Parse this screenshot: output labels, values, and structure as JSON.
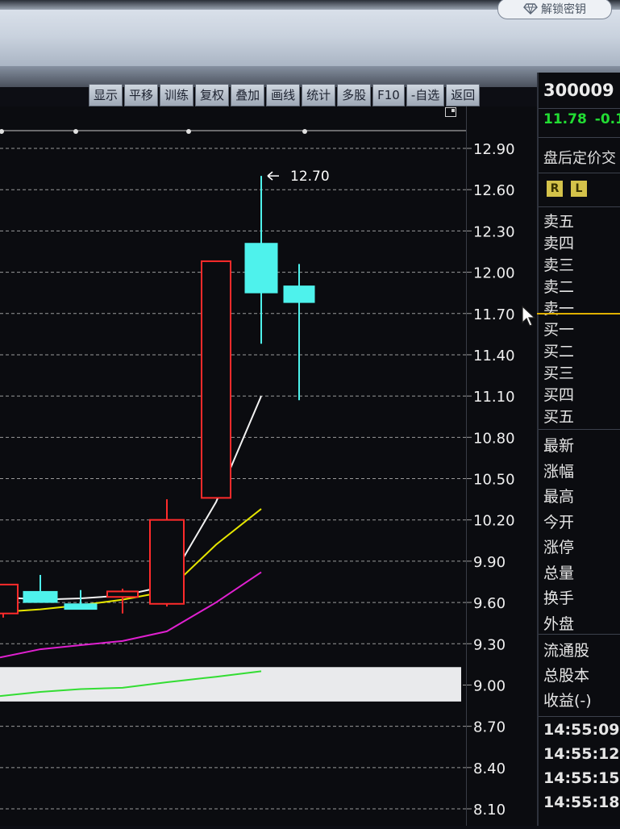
{
  "header": {
    "unlock_label": "解锁密钥"
  },
  "toolbar": {
    "buttons": [
      "显示",
      "平移",
      "训练",
      "复权",
      "叠加",
      "画线",
      "统计",
      "多股",
      "F10",
      "-自选",
      "返回"
    ]
  },
  "quote": {
    "code": "300009",
    "price": "11.78",
    "change": "-0.1",
    "after_hours_label": "盘后定价交",
    "r_label": "R",
    "l_label": "L",
    "asks": [
      "卖五",
      "卖四",
      "卖三",
      "卖二",
      "卖一"
    ],
    "bids": [
      "买一",
      "买二",
      "买三",
      "买四",
      "买五"
    ],
    "stats": [
      "最新",
      "涨幅",
      "最高",
      "今开",
      "涨停",
      "总量",
      "换手",
      "外盘"
    ],
    "shares": [
      "流通股",
      "总股本",
      "收益(-)"
    ],
    "ticks": [
      "14:55:09",
      "14:55:12",
      "14:55:15",
      "14:55:18"
    ]
  },
  "chart_data": {
    "type": "candlestick",
    "y_ticks": [
      "12.90",
      "12.60",
      "12.30",
      "12.00",
      "11.70",
      "11.40",
      "11.10",
      "10.80",
      "10.50",
      "10.20",
      "9.90",
      "9.60",
      "9.30",
      "9.00",
      "8.70",
      "8.40",
      "8.10"
    ],
    "ylim": [
      8.1,
      12.9
    ],
    "high_annotation": "12.70",
    "candles": [
      {
        "open": 9.52,
        "close": 9.73,
        "high": 9.73,
        "low": 9.49,
        "color": "red"
      },
      {
        "open": 9.6,
        "close": 9.68,
        "high": 9.8,
        "low": 9.6,
        "color": "cyan"
      },
      {
        "open": 9.55,
        "close": 9.59,
        "high": 9.69,
        "low": 9.55,
        "color": "cyan"
      },
      {
        "open": 9.68,
        "close": 9.64,
        "high": 9.7,
        "low": 9.52,
        "color": "red"
      },
      {
        "open": 9.59,
        "close": 10.2,
        "high": 10.35,
        "low": 9.57,
        "color": "red"
      },
      {
        "open": 10.36,
        "close": 12.08,
        "high": 12.08,
        "low": 10.36,
        "color": "red"
      },
      {
        "open": 12.21,
        "close": 11.85,
        "high": 12.7,
        "low": 11.48,
        "color": "cyan"
      },
      {
        "open": 11.9,
        "close": 11.78,
        "high": 12.06,
        "low": 11.07,
        "color": "cyan"
      }
    ],
    "series": [
      {
        "values": [
          9.64,
          9.62,
          9.63,
          9.65,
          9.72,
          10.33,
          11.1
        ],
        "color": "#f2f2f2"
      },
      {
        "values": [
          9.53,
          9.55,
          9.58,
          9.62,
          9.68,
          10.02,
          10.28
        ],
        "color": "#e6e600"
      },
      {
        "values": [
          9.2,
          9.26,
          9.29,
          9.32,
          9.39,
          9.6,
          9.82
        ],
        "color": "#e020d0"
      },
      {
        "values": [
          8.92,
          8.95,
          8.97,
          8.98,
          9.02,
          9.06,
          9.1
        ],
        "color": "#33dd33"
      }
    ]
  }
}
